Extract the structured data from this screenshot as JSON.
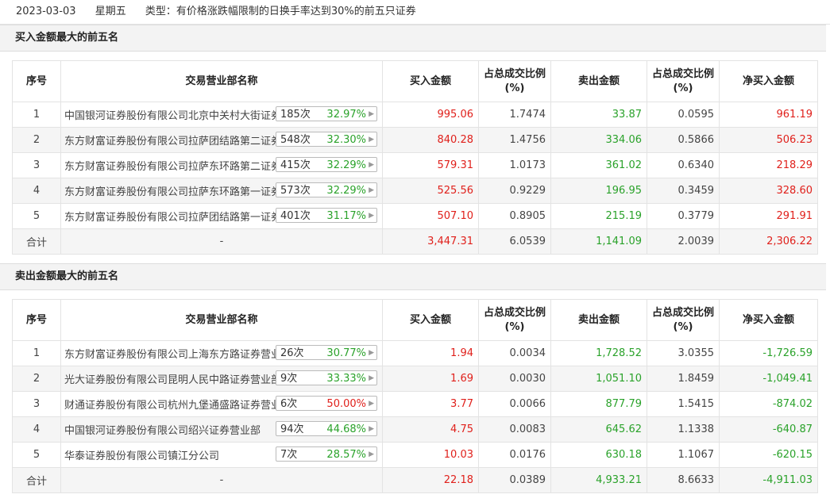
{
  "header": {
    "date": "2023-03-03",
    "weekday": "星期五",
    "type_label": "类型：有价格涨跌幅限制的日换手率达到30%的前五只证券"
  },
  "columns": [
    "序号",
    "交易营业部名称",
    "买入金额",
    "占总成交比例(%)",
    "卖出金额",
    "占总成交比例(%)",
    "净买入金额"
  ],
  "colors": {
    "positive": "#e0201b",
    "negative": "#2aa22a",
    "pct_red": "#e0201b",
    "pct_green": "#2aa22a"
  },
  "buy_section": {
    "title": "买入金额最大的前五名",
    "rows": [
      {
        "no": "1",
        "name": "中国银河证券股份有限公司北京中关村大街证券营业部",
        "count": "185次",
        "pct": "32.97%",
        "pct_color": "green",
        "buy": "995.06",
        "buy_ratio": "1.7474",
        "sell": "33.87",
        "sell_ratio": "0.0595",
        "net": "961.19",
        "net_color": "red"
      },
      {
        "no": "2",
        "name": "东方财富证券股份有限公司拉萨团结路第二证券营业部",
        "count": "548次",
        "pct": "32.30%",
        "pct_color": "green",
        "buy": "840.28",
        "buy_ratio": "1.4756",
        "sell": "334.06",
        "sell_ratio": "0.5866",
        "net": "506.23",
        "net_color": "red"
      },
      {
        "no": "3",
        "name": "东方财富证券股份有限公司拉萨东环路第二证券营业部",
        "count": "415次",
        "pct": "32.29%",
        "pct_color": "green",
        "buy": "579.31",
        "buy_ratio": "1.0173",
        "sell": "361.02",
        "sell_ratio": "0.6340",
        "net": "218.29",
        "net_color": "red"
      },
      {
        "no": "4",
        "name": "东方财富证券股份有限公司拉萨东环路第一证券营业部",
        "count": "573次",
        "pct": "32.29%",
        "pct_color": "green",
        "buy": "525.56",
        "buy_ratio": "0.9229",
        "sell": "196.95",
        "sell_ratio": "0.3459",
        "net": "328.60",
        "net_color": "red"
      },
      {
        "no": "5",
        "name": "东方财富证券股份有限公司拉萨团结路第一证券营业部",
        "count": "401次",
        "pct": "31.17%",
        "pct_color": "green",
        "buy": "507.10",
        "buy_ratio": "0.8905",
        "sell": "215.19",
        "sell_ratio": "0.3779",
        "net": "291.91",
        "net_color": "red"
      }
    ],
    "total": {
      "label": "合计",
      "name": "-",
      "buy": "3,447.31",
      "buy_ratio": "6.0539",
      "sell": "1,141.09",
      "sell_ratio": "2.0039",
      "net": "2,306.22",
      "net_color": "red"
    }
  },
  "sell_section": {
    "title": "卖出金额最大的前五名",
    "rows": [
      {
        "no": "1",
        "name": "东方财富证券股份有限公司上海东方路证券营业部",
        "count": "26次",
        "pct": "30.77%",
        "pct_color": "green",
        "buy": "1.94",
        "buy_ratio": "0.0034",
        "sell": "1,728.52",
        "sell_ratio": "3.0355",
        "net": "-1,726.59",
        "net_color": "green"
      },
      {
        "no": "2",
        "name": "光大证券股份有限公司昆明人民中路证券营业部",
        "count": "9次",
        "pct": "33.33%",
        "pct_color": "green",
        "buy": "1.69",
        "buy_ratio": "0.0030",
        "sell": "1,051.10",
        "sell_ratio": "1.8459",
        "net": "-1,049.41",
        "net_color": "green"
      },
      {
        "no": "3",
        "name": "财通证券股份有限公司杭州九堡通盛路证券营业部",
        "count": "6次",
        "pct": "50.00%",
        "pct_color": "red",
        "buy": "3.77",
        "buy_ratio": "0.0066",
        "sell": "877.79",
        "sell_ratio": "1.5415",
        "net": "-874.02",
        "net_color": "green"
      },
      {
        "no": "4",
        "name": "中国银河证券股份有限公司绍兴证券营业部",
        "count": "94次",
        "pct": "44.68%",
        "pct_color": "green",
        "buy": "4.75",
        "buy_ratio": "0.0083",
        "sell": "645.62",
        "sell_ratio": "1.1338",
        "net": "-640.87",
        "net_color": "green"
      },
      {
        "no": "5",
        "name": "华泰证券股份有限公司镇江分公司",
        "count": "7次",
        "pct": "28.57%",
        "pct_color": "green",
        "buy": "10.03",
        "buy_ratio": "0.0176",
        "sell": "630.18",
        "sell_ratio": "1.1067",
        "net": "-620.15",
        "net_color": "green"
      }
    ],
    "total": {
      "label": "合计",
      "name": "-",
      "buy": "22.18",
      "buy_ratio": "0.0389",
      "sell": "4,933.21",
      "sell_ratio": "8.6633",
      "net": "-4,911.03",
      "net_color": "green"
    }
  }
}
